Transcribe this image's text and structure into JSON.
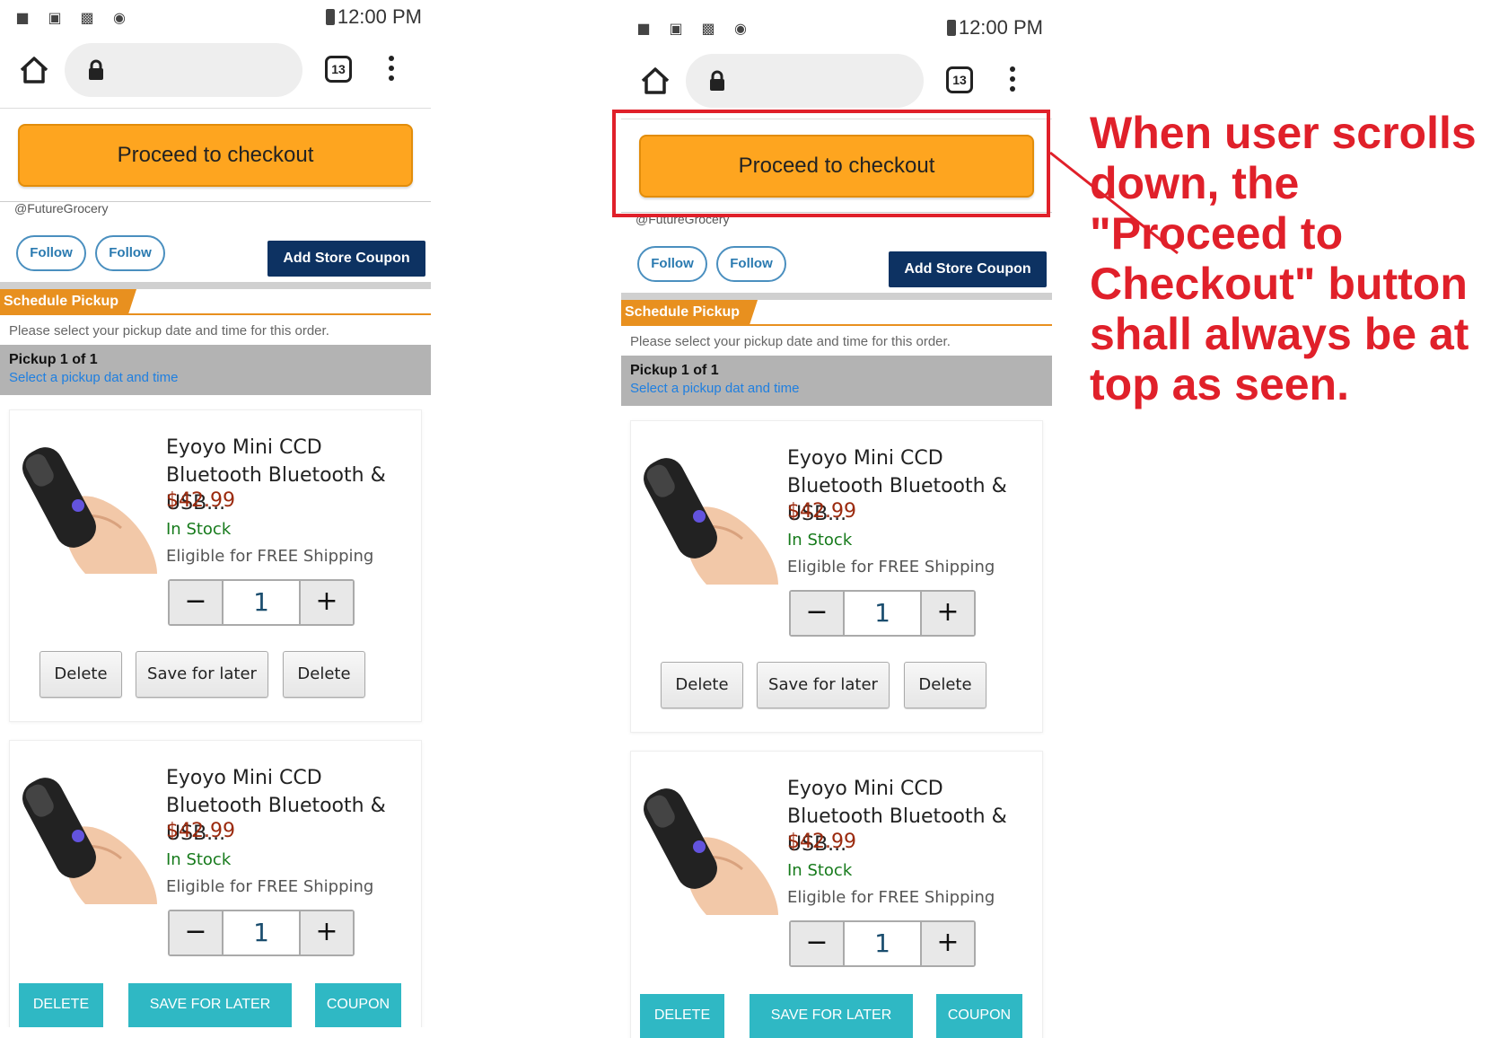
{
  "status_bar": {
    "time": "12:00 PM"
  },
  "browser": {
    "tab_count": "13"
  },
  "checkout": {
    "label": "Proceed to checkout"
  },
  "store": {
    "handle": "@FutureGrocery",
    "follow_labels": [
      "Follow",
      "Follow"
    ],
    "coupon_label": "Add Store Coupon"
  },
  "pickup": {
    "section_label": "Schedule Pickup",
    "note": "Please select your pickup date and time for this order.",
    "title": "Pickup 1 of 1",
    "link": "Select a pickup dat and time"
  },
  "products": [
    {
      "name": "Eyoyo Mini CCD Bluetooth Bluetooth & USB...",
      "price": "$42.99",
      "stock": "In Stock",
      "shipping": "Eligible for FREE Shipping",
      "qty": "1",
      "actions": [
        "Delete",
        "Save for later",
        "Delete"
      ]
    },
    {
      "name": "Eyoyo Mini CCD Bluetooth Bluetooth & USB...",
      "price": "$42.99",
      "stock": "In Stock",
      "shipping": "Eligible for FREE Shipping",
      "qty": "1",
      "actions": [
        "DELETE",
        "SAVE FOR LATER",
        "COUPON"
      ]
    }
  ],
  "qty_controls": {
    "minus": "−",
    "plus": "+"
  },
  "annotation": {
    "text": "When user scrolls down, the \"Proceed to Checkout\" button shall always be at top as seen.",
    "color": "#e0202a"
  },
  "colors": {
    "checkout": "#fea51f",
    "coupon_btn": "#0d3262",
    "schedule": "#e8901f",
    "teal_btn": "#2fb8c4",
    "price": "#9b2a0e",
    "stock": "#167a1b"
  }
}
